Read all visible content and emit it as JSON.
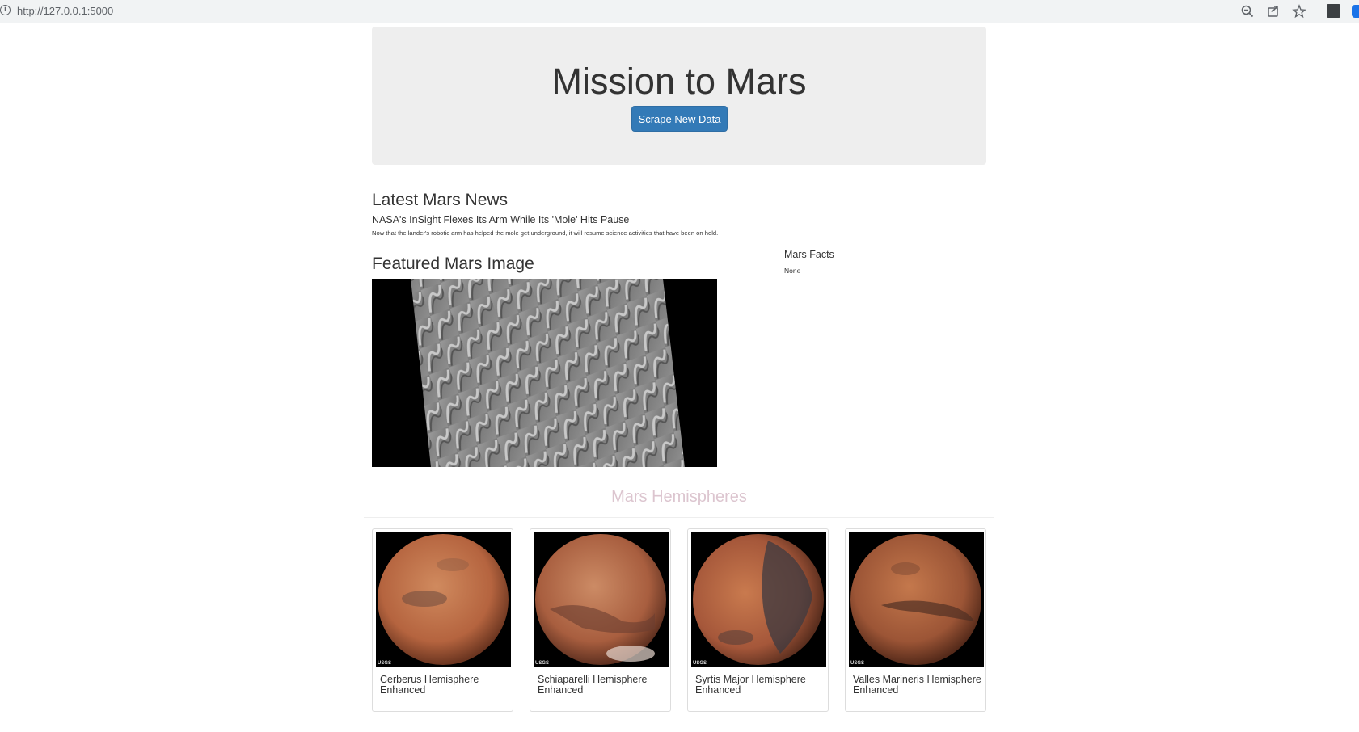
{
  "browser": {
    "url": "http://127.0.0.1:5000",
    "info_icon": "info-icon",
    "icons": [
      "zoom-out-icon",
      "share-icon",
      "star-icon",
      "extension-icon",
      "profile-icon"
    ]
  },
  "jumbotron": {
    "title": "Mission to Mars",
    "button_label": "Scrape New Data",
    "button_color": "#337ab7"
  },
  "news": {
    "heading": "Latest Mars News",
    "title": "NASA's InSight Flexes Its Arm While Its 'Mole' Hits Pause",
    "paragraph": "Now that the lander's robotic arm has helped the mole get underground, it will resume science activities that have been on hold."
  },
  "featured": {
    "heading": "Featured Mars Image"
  },
  "facts": {
    "heading": "Mars Facts",
    "value": "None"
  },
  "hemispheres": {
    "heading": "Mars Hemispheres",
    "heading_color": "#dcc5cf",
    "items": [
      {
        "title": "Cerberus Hemisphere Enhanced",
        "image_label": "USGS"
      },
      {
        "title": "Schiaparelli Hemisphere Enhanced",
        "image_label": "USGS"
      },
      {
        "title": "Syrtis Major Hemisphere Enhanced",
        "image_label": "USGS"
      },
      {
        "title": "Valles Marineris Hemisphere Enhanced",
        "image_label": "USGS"
      }
    ]
  }
}
